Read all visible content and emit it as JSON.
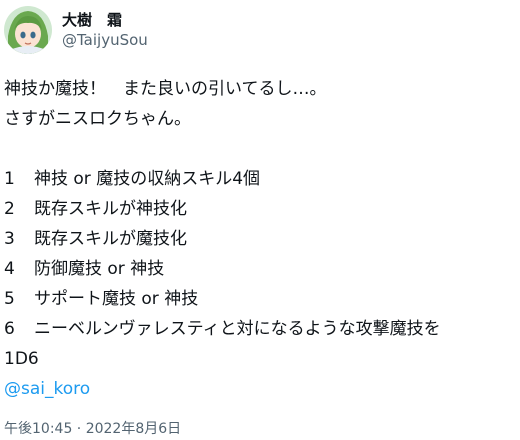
{
  "author": {
    "display_name": "大樹　霜",
    "handle": "@TaijyuSou",
    "avatar": "avatar-image"
  },
  "tweet": {
    "lines": [
      "神技か魔技！　また良いの引いてるし…。",
      "さすがニスロクちゃん。"
    ],
    "list": [
      {
        "num": "1",
        "text": "神技 or 魔技の収納スキル4個"
      },
      {
        "num": "2",
        "text": "既存スキルが神技化"
      },
      {
        "num": "3",
        "text": "既存スキルが魔技化"
      },
      {
        "num": "4",
        "text": "防御魔技 or 神技"
      },
      {
        "num": "5",
        "text": "サポート魔技 or 神技"
      },
      {
        "num": "6",
        "text": "ニーベルンヴァレスティと対になるような攻撃魔技を"
      }
    ],
    "dice": "1D6",
    "mention": "@sai_koro",
    "timestamp": "午後10:45 · 2022年8月6日"
  }
}
